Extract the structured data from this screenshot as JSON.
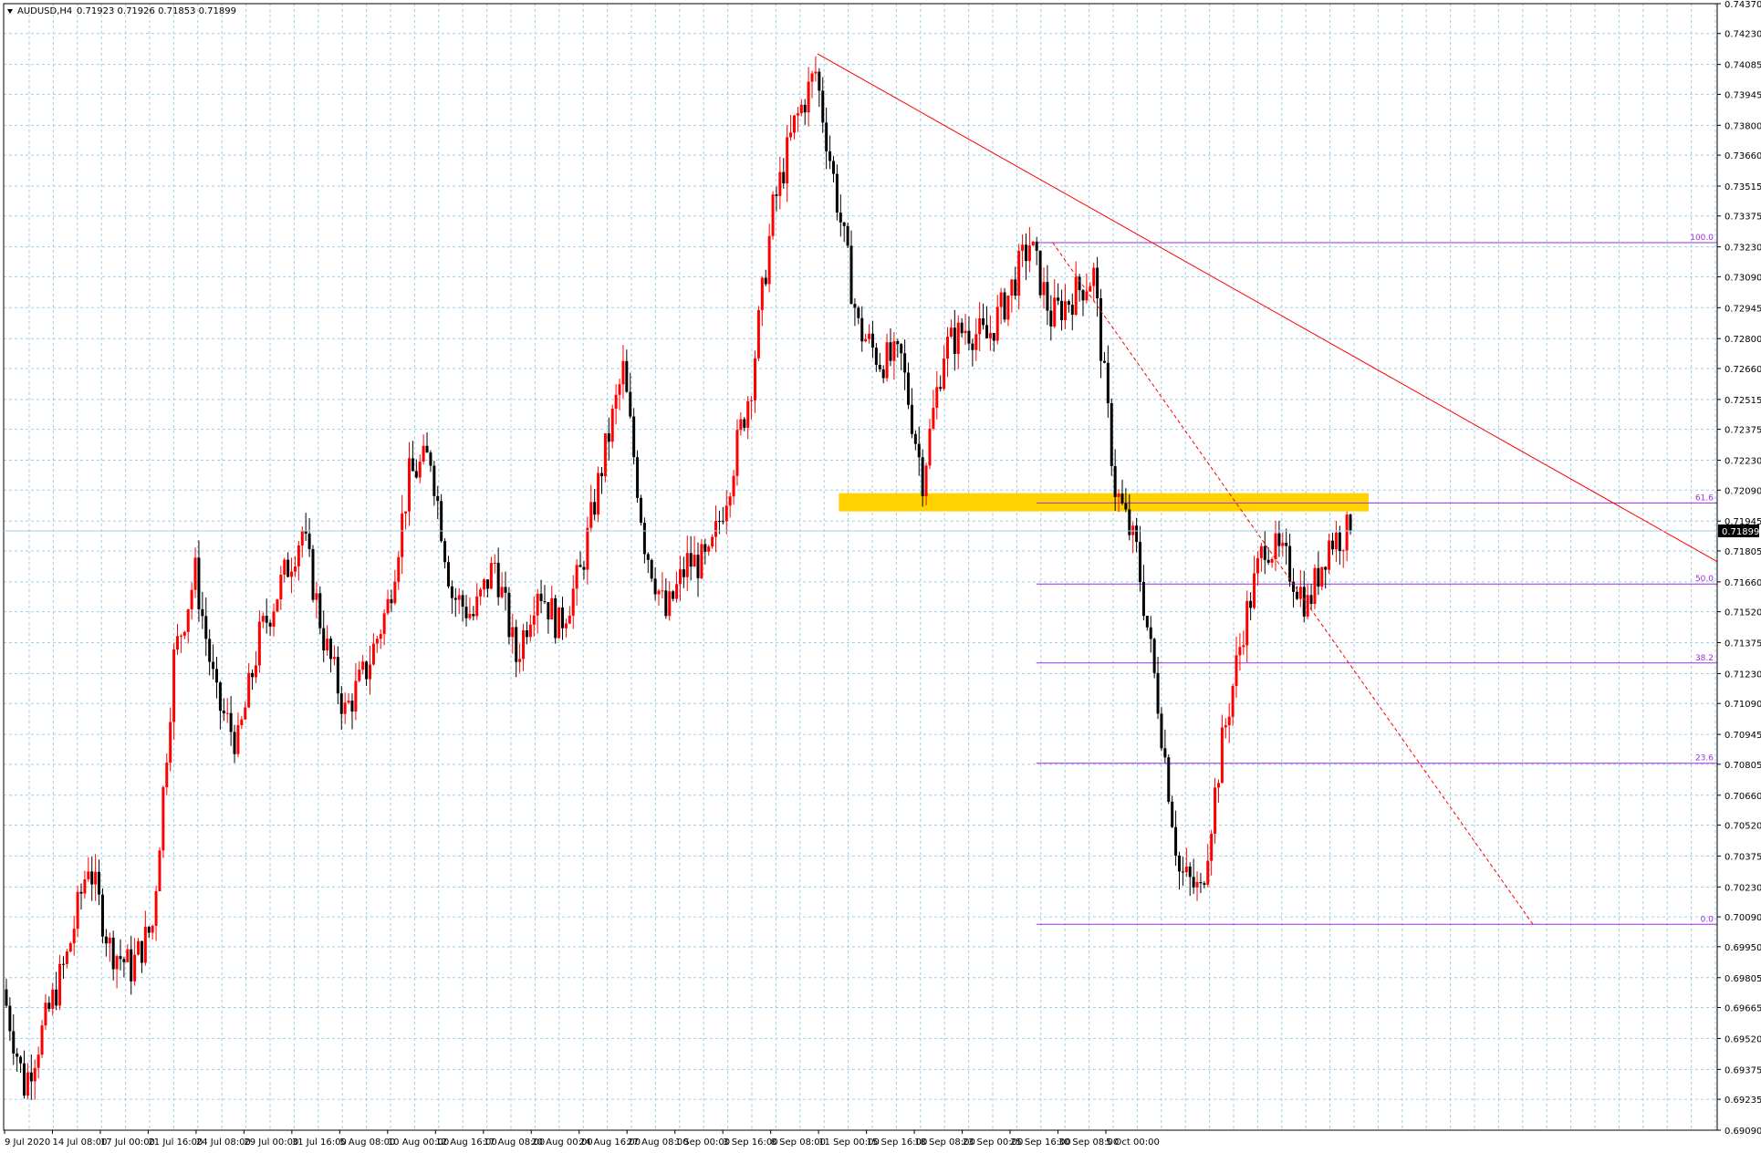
{
  "header": {
    "symbol": "AUDUSD,H4",
    "ohlc": "0.71923 0.71926 0.71853 0.71899"
  },
  "colors": {
    "background": "#ffffff",
    "grid": "#9fcfe8",
    "bull_candle": "#ff0000",
    "bear_candle": "#000000",
    "trendline": "#ff0000",
    "fib_line": "#9b30d9",
    "zone": "#ffd200",
    "price_label_bg": "#000000"
  },
  "chart_data": {
    "type": "candlestick",
    "instrument": "AUDUSD",
    "timeframe": "H4",
    "last_price": "0.71899",
    "ylim": [
      0.6909,
      0.7437
    ],
    "y_ticks": [
      "0.74370",
      "0.74230",
      "0.74085",
      "0.73945",
      "0.73800",
      "0.73660",
      "0.73515",
      "0.73375",
      "0.73230",
      "0.73090",
      "0.72945",
      "0.72800",
      "0.72660",
      "0.72515",
      "0.72375",
      "0.72230",
      "0.72090",
      "0.71945",
      "0.71805",
      "0.71660",
      "0.71520",
      "0.71375",
      "0.71230",
      "0.71090",
      "0.70945",
      "0.70805",
      "0.70660",
      "0.70520",
      "0.70375",
      "0.70230",
      "0.70090",
      "0.69950",
      "0.69805",
      "0.69665",
      "0.69520",
      "0.69375",
      "0.69235",
      "0.69090"
    ],
    "x_ticks": [
      "9 Jul 2020",
      "14 Jul 08:00",
      "17 Jul 00:00",
      "21 Jul 16:00",
      "24 Jul 08:00",
      "29 Jul 00:00",
      "31 Jul 16:00",
      "5 Aug 08:00",
      "10 Aug 00:00",
      "12 Aug 16:00",
      "17 Aug 08:00",
      "20 Aug 00:00",
      "24 Aug 16:00",
      "27 Aug 08:00",
      "1 Sep 00:00",
      "3 Sep 16:00",
      "8 Sep 08:00",
      "11 Sep 00:00",
      "15 Sep 16:00",
      "18 Sep 08:00",
      "23 Sep 00:00",
      "25 Sep 16:00",
      "30 Sep 08:00",
      "5 Oct 00:00"
    ],
    "price_path": [
      {
        "t": "9 Jul 2020",
        "price": 0.6975
      },
      {
        "t": "10 Jul",
        "price": 0.693
      },
      {
        "t": "13 Jul",
        "price": 0.696
      },
      {
        "t": "14 Jul",
        "price": 0.699
      },
      {
        "t": "15 Jul",
        "price": 0.7035
      },
      {
        "t": "16 Jul",
        "price": 0.6995
      },
      {
        "t": "17 Jul",
        "price": 0.6985
      },
      {
        "t": "20 Jul",
        "price": 0.7005
      },
      {
        "t": "21 Jul",
        "price": 0.713
      },
      {
        "t": "22 Jul",
        "price": 0.717
      },
      {
        "t": "23 Jul",
        "price": 0.711
      },
      {
        "t": "24 Jul",
        "price": 0.709
      },
      {
        "t": "27 Jul",
        "price": 0.714
      },
      {
        "t": "28 Jul",
        "price": 0.7165
      },
      {
        "t": "29 Jul",
        "price": 0.719
      },
      {
        "t": "30 Jul",
        "price": 0.714
      },
      {
        "t": "31 Jul",
        "price": 0.7105
      },
      {
        "t": "3 Aug",
        "price": 0.7125
      },
      {
        "t": "4 Aug",
        "price": 0.7155
      },
      {
        "t": "5 Aug",
        "price": 0.7215
      },
      {
        "t": "6 Aug",
        "price": 0.7225
      },
      {
        "t": "7 Aug",
        "price": 0.716
      },
      {
        "t": "10 Aug",
        "price": 0.715
      },
      {
        "t": "11 Aug",
        "price": 0.7175
      },
      {
        "t": "12 Aug",
        "price": 0.713
      },
      {
        "t": "13 Aug",
        "price": 0.7165
      },
      {
        "t": "14 Aug",
        "price": 0.7145
      },
      {
        "t": "17 Aug",
        "price": 0.717
      },
      {
        "t": "18 Aug",
        "price": 0.722
      },
      {
        "t": "19 Aug",
        "price": 0.7265
      },
      {
        "t": "20 Aug",
        "price": 0.7185
      },
      {
        "t": "21 Aug",
        "price": 0.715
      },
      {
        "t": "24 Aug",
        "price": 0.7175
      },
      {
        "t": "25 Aug",
        "price": 0.7175
      },
      {
        "t": "26 Aug",
        "price": 0.7215
      },
      {
        "t": "27 Aug",
        "price": 0.726
      },
      {
        "t": "28 Aug",
        "price": 0.734
      },
      {
        "t": "31 Aug",
        "price": 0.738
      },
      {
        "t": "1 Sep",
        "price": 0.7405
      },
      {
        "t": "2 Sep",
        "price": 0.7345
      },
      {
        "t": "3 Sep",
        "price": 0.7285
      },
      {
        "t": "4 Sep",
        "price": 0.727
      },
      {
        "t": "7 Sep",
        "price": 0.727
      },
      {
        "t": "8 Sep",
        "price": 0.7215
      },
      {
        "t": "9 Sep",
        "price": 0.7275
      },
      {
        "t": "10 Sep",
        "price": 0.7285
      },
      {
        "t": "11 Sep",
        "price": 0.728
      },
      {
        "t": "14 Sep",
        "price": 0.73
      },
      {
        "t": "15 Sep",
        "price": 0.7325
      },
      {
        "t": "16 Sep",
        "price": 0.729
      },
      {
        "t": "17 Sep",
        "price": 0.73
      },
      {
        "t": "18 Sep",
        "price": 0.731
      },
      {
        "t": "21 Sep",
        "price": 0.721
      },
      {
        "t": "22 Sep",
        "price": 0.718
      },
      {
        "t": "23 Sep",
        "price": 0.711
      },
      {
        "t": "24 Sep",
        "price": 0.703
      },
      {
        "t": "25 Sep",
        "price": 0.702
      },
      {
        "t": "28 Sep",
        "price": 0.709
      },
      {
        "t": "29 Sep",
        "price": 0.7145
      },
      {
        "t": "30 Sep",
        "price": 0.7185
      },
      {
        "t": "1 Oct",
        "price": 0.7175
      },
      {
        "t": "2 Oct",
        "price": 0.7155
      },
      {
        "t": "5 Oct",
        "price": 0.7185
      },
      {
        "t": "6 Oct",
        "price": 0.71899
      }
    ],
    "fibonacci": [
      {
        "label": "100.0",
        "price": 0.7325
      },
      {
        "label": "61.6",
        "price": 0.7203
      },
      {
        "label": "50.0",
        "price": 0.7165
      },
      {
        "label": "38.2",
        "price": 0.7128
      },
      {
        "label": "23.6",
        "price": 0.7081
      },
      {
        "label": "0.0",
        "price": 0.70055
      }
    ],
    "trendline": {
      "from": {
        "t": "1 Sep",
        "price": 0.74135
      },
      "to": {
        "t": "7 Oct",
        "price": 0.71755
      }
    },
    "dashed_line": {
      "from": {
        "t": "16 Sep",
        "price": 0.7325
      },
      "to": {
        "t": "7 Oct",
        "price": 0.70055
      }
    },
    "zone": {
      "from": "2 Sep",
      "to": "6 Oct",
      "price_top": 0.7205,
      "price_bottom": 0.72
    },
    "grid": true
  }
}
